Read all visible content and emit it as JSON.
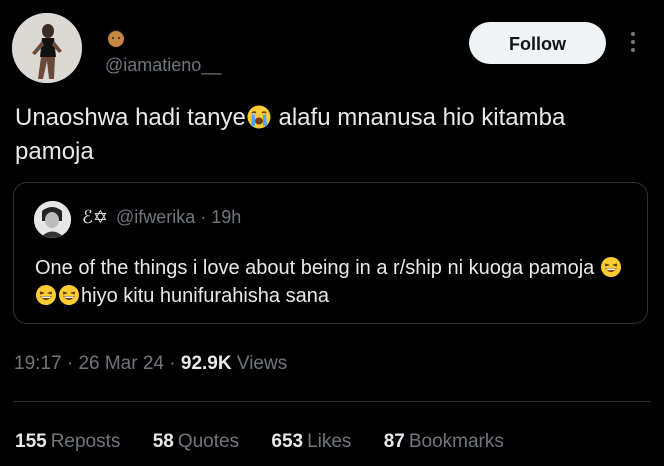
{
  "author": {
    "handle": "@iamatieno__"
  },
  "actions": {
    "follow_label": "Follow"
  },
  "tweet": {
    "text_part1": "Unaoshwa hadi tanye",
    "text_part2": " alafu mnanusa hio kitamba pamoja"
  },
  "quote": {
    "name": "ℰ✡",
    "handle": "@ifwerika",
    "time": "19h",
    "text_part1": "One of the things i love about being in a r/ship ni kuoga pamoja ",
    "text_part2": "hiyo kitu hunifurahisha sana"
  },
  "meta": {
    "time": "19:17",
    "date": "26 Mar 24",
    "views_count": "92.9K",
    "views_label": "Views"
  },
  "stats": {
    "reposts": {
      "count": "155",
      "label": "Reposts"
    },
    "quotes": {
      "count": "58",
      "label": "Quotes"
    },
    "likes": {
      "count": "653",
      "label": "Likes"
    },
    "bookmarks": {
      "count": "87",
      "label": "Bookmarks"
    }
  },
  "icons": {
    "name_emoji": "person-face-emoji-icon",
    "crying_emoji": "loudly-crying-face-icon",
    "laughing_emoji": "grinning-squinting-face-icon",
    "more": "more-options-icon"
  },
  "colors": {
    "background": "#000000",
    "text": "#e7e9ea",
    "secondary_text": "#71767b",
    "border": "#2f3336",
    "button": "#eff3f4"
  }
}
